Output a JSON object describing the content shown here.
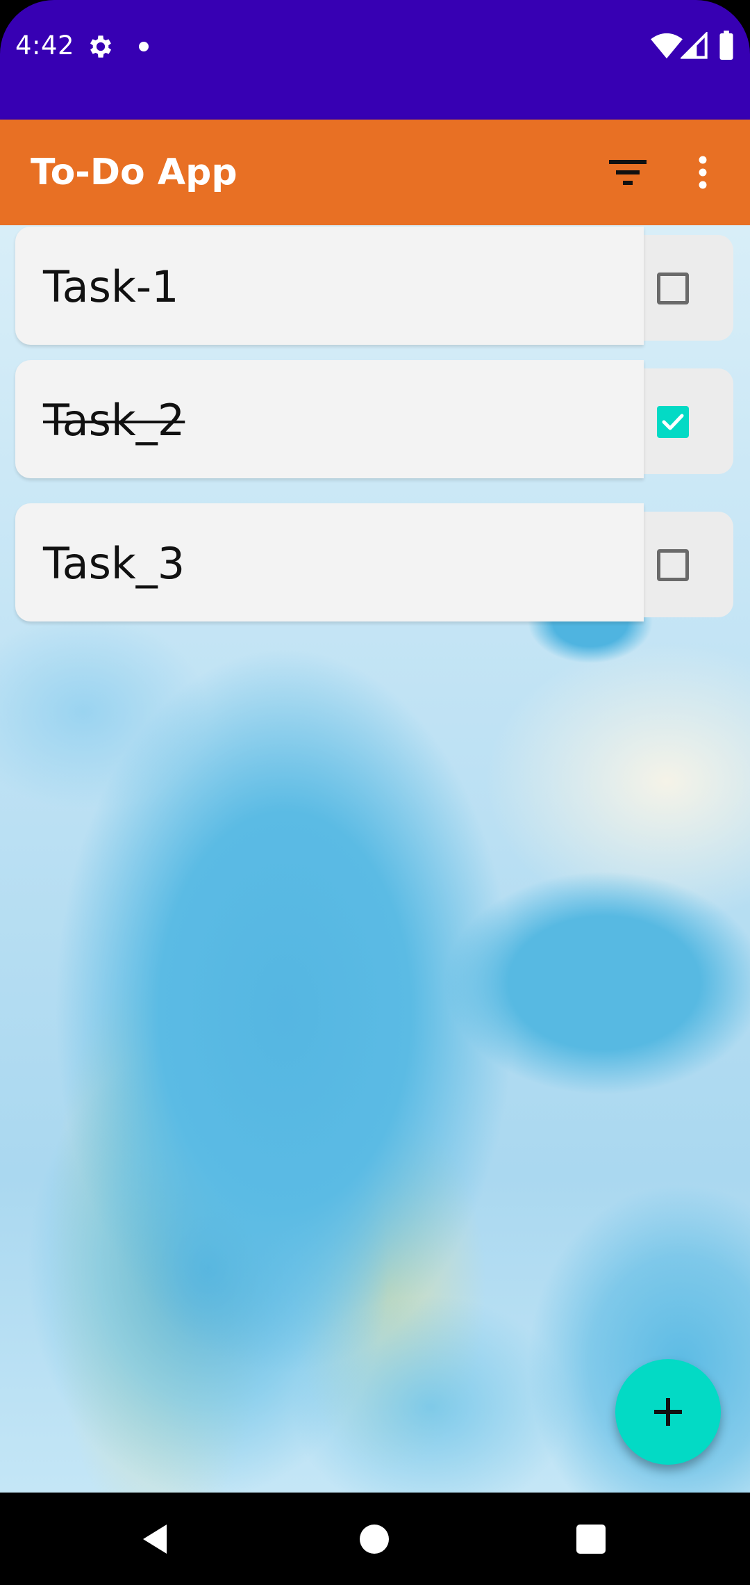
{
  "status_bar": {
    "time": "4:42",
    "icons": [
      "gear-icon",
      "dot-icon",
      "wifi-icon",
      "signal-icon",
      "battery-icon"
    ]
  },
  "app_bar": {
    "title": "To-Do App",
    "actions": [
      "filter-icon",
      "more-vert-icon"
    ]
  },
  "tasks": [
    {
      "title": "Task-1",
      "done": false
    },
    {
      "title": "Task_2",
      "done": true
    },
    {
      "title": "Task_3",
      "done": false
    }
  ],
  "fab": {
    "icon": "add-icon",
    "label": "+"
  },
  "navigation": {
    "buttons": [
      "back-icon",
      "home-icon",
      "recents-icon"
    ]
  },
  "colors": {
    "status_bar": "#3700B3",
    "app_bar": "#E87024",
    "accent": "#03DAC5"
  }
}
